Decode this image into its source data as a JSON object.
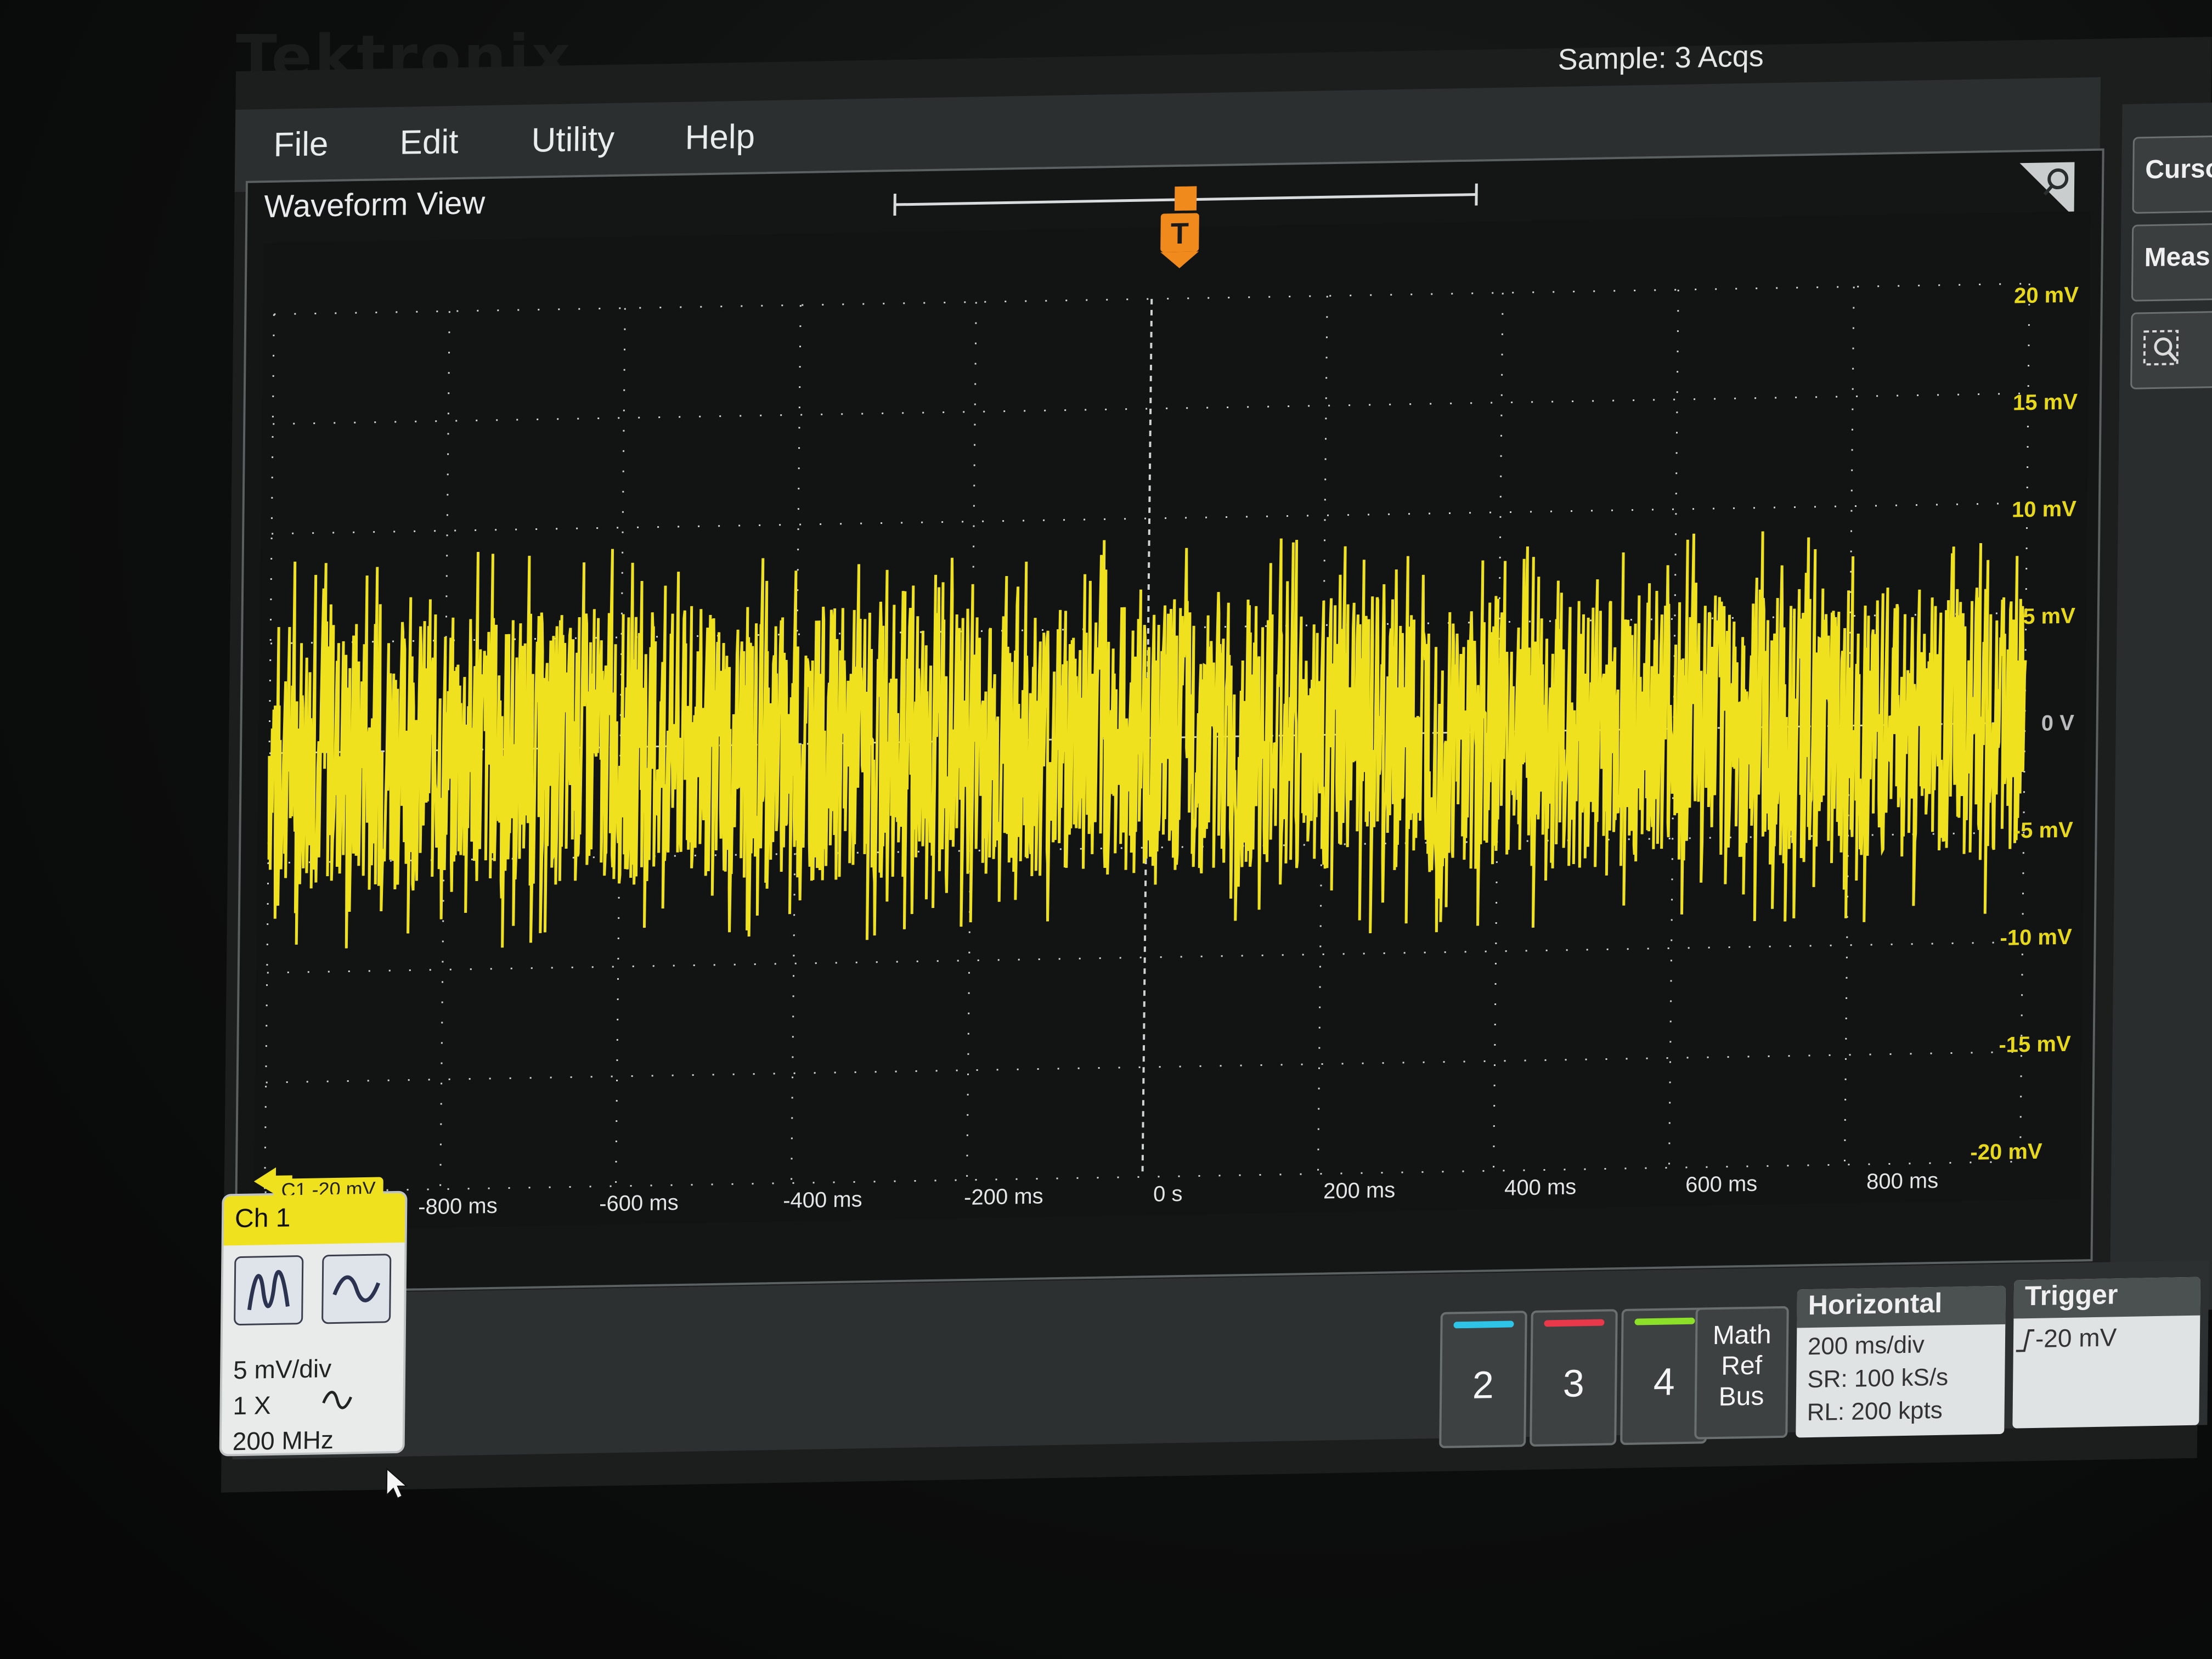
{
  "bezel": {
    "logo": "Tektronix"
  },
  "menu": {
    "file": "File",
    "edit": "Edit",
    "utility": "Utility",
    "help": "Help"
  },
  "status": {
    "acquisition": "Sample: 3 Acqs"
  },
  "waveform_view": {
    "title": "Waveform View"
  },
  "sidebar": {
    "cursors": "Curso",
    "measure": "Meas"
  },
  "trigger_marker": "T",
  "y_axis": {
    "labels": [
      "20 mV",
      "15 mV",
      "10 mV",
      "5 mV",
      "0 V",
      "-5 mV",
      "-10 mV",
      "-15 mV",
      "-20 mV"
    ]
  },
  "x_axis": {
    "labels": [
      "-800 ms",
      "-600 ms",
      "-400 ms",
      "-200 ms",
      "0 s",
      "200 ms",
      "400 ms",
      "600 ms",
      "800 ms"
    ]
  },
  "channel1": {
    "tab_label": "C1 -20 mV",
    "title": "Ch 1",
    "scale": "5 mV/div",
    "probe": "1 X",
    "bandwidth": "200 MHz",
    "coupling_icon": "ac-coupling-icon",
    "color": "#efe11e"
  },
  "channel_buttons": [
    {
      "label": "2",
      "color": "#2ec4e8"
    },
    {
      "label": "3",
      "color": "#e8384a"
    },
    {
      "label": "4",
      "color": "#8ce02a"
    }
  ],
  "math_ref_bus": {
    "line1": "Math",
    "line2": "Ref",
    "line3": "Bus"
  },
  "horizontal": {
    "title": "Horizontal",
    "scale": "200 ms/div",
    "sample_rate": "SR: 100 kS/s",
    "record_length": "RL: 200 kpts"
  },
  "trigger": {
    "title": "Trigger",
    "level": "-20 mV",
    "slope_icon": "rising-edge-icon"
  },
  "colors": {
    "trace": "#efe11e",
    "trigger_marker": "#f08a1c",
    "grid": "#cfd3d3"
  },
  "chart_data": {
    "type": "line",
    "x_range": [
      -1000,
      1000
    ],
    "y_range": [
      -20,
      20
    ],
    "x_unit": "ms",
    "y_unit": "mV",
    "grid": true,
    "series": [
      {
        "name": "Ch 1",
        "noise_band_mV": [
          -7,
          7
        ],
        "offset_mV": 0
      }
    ]
  }
}
